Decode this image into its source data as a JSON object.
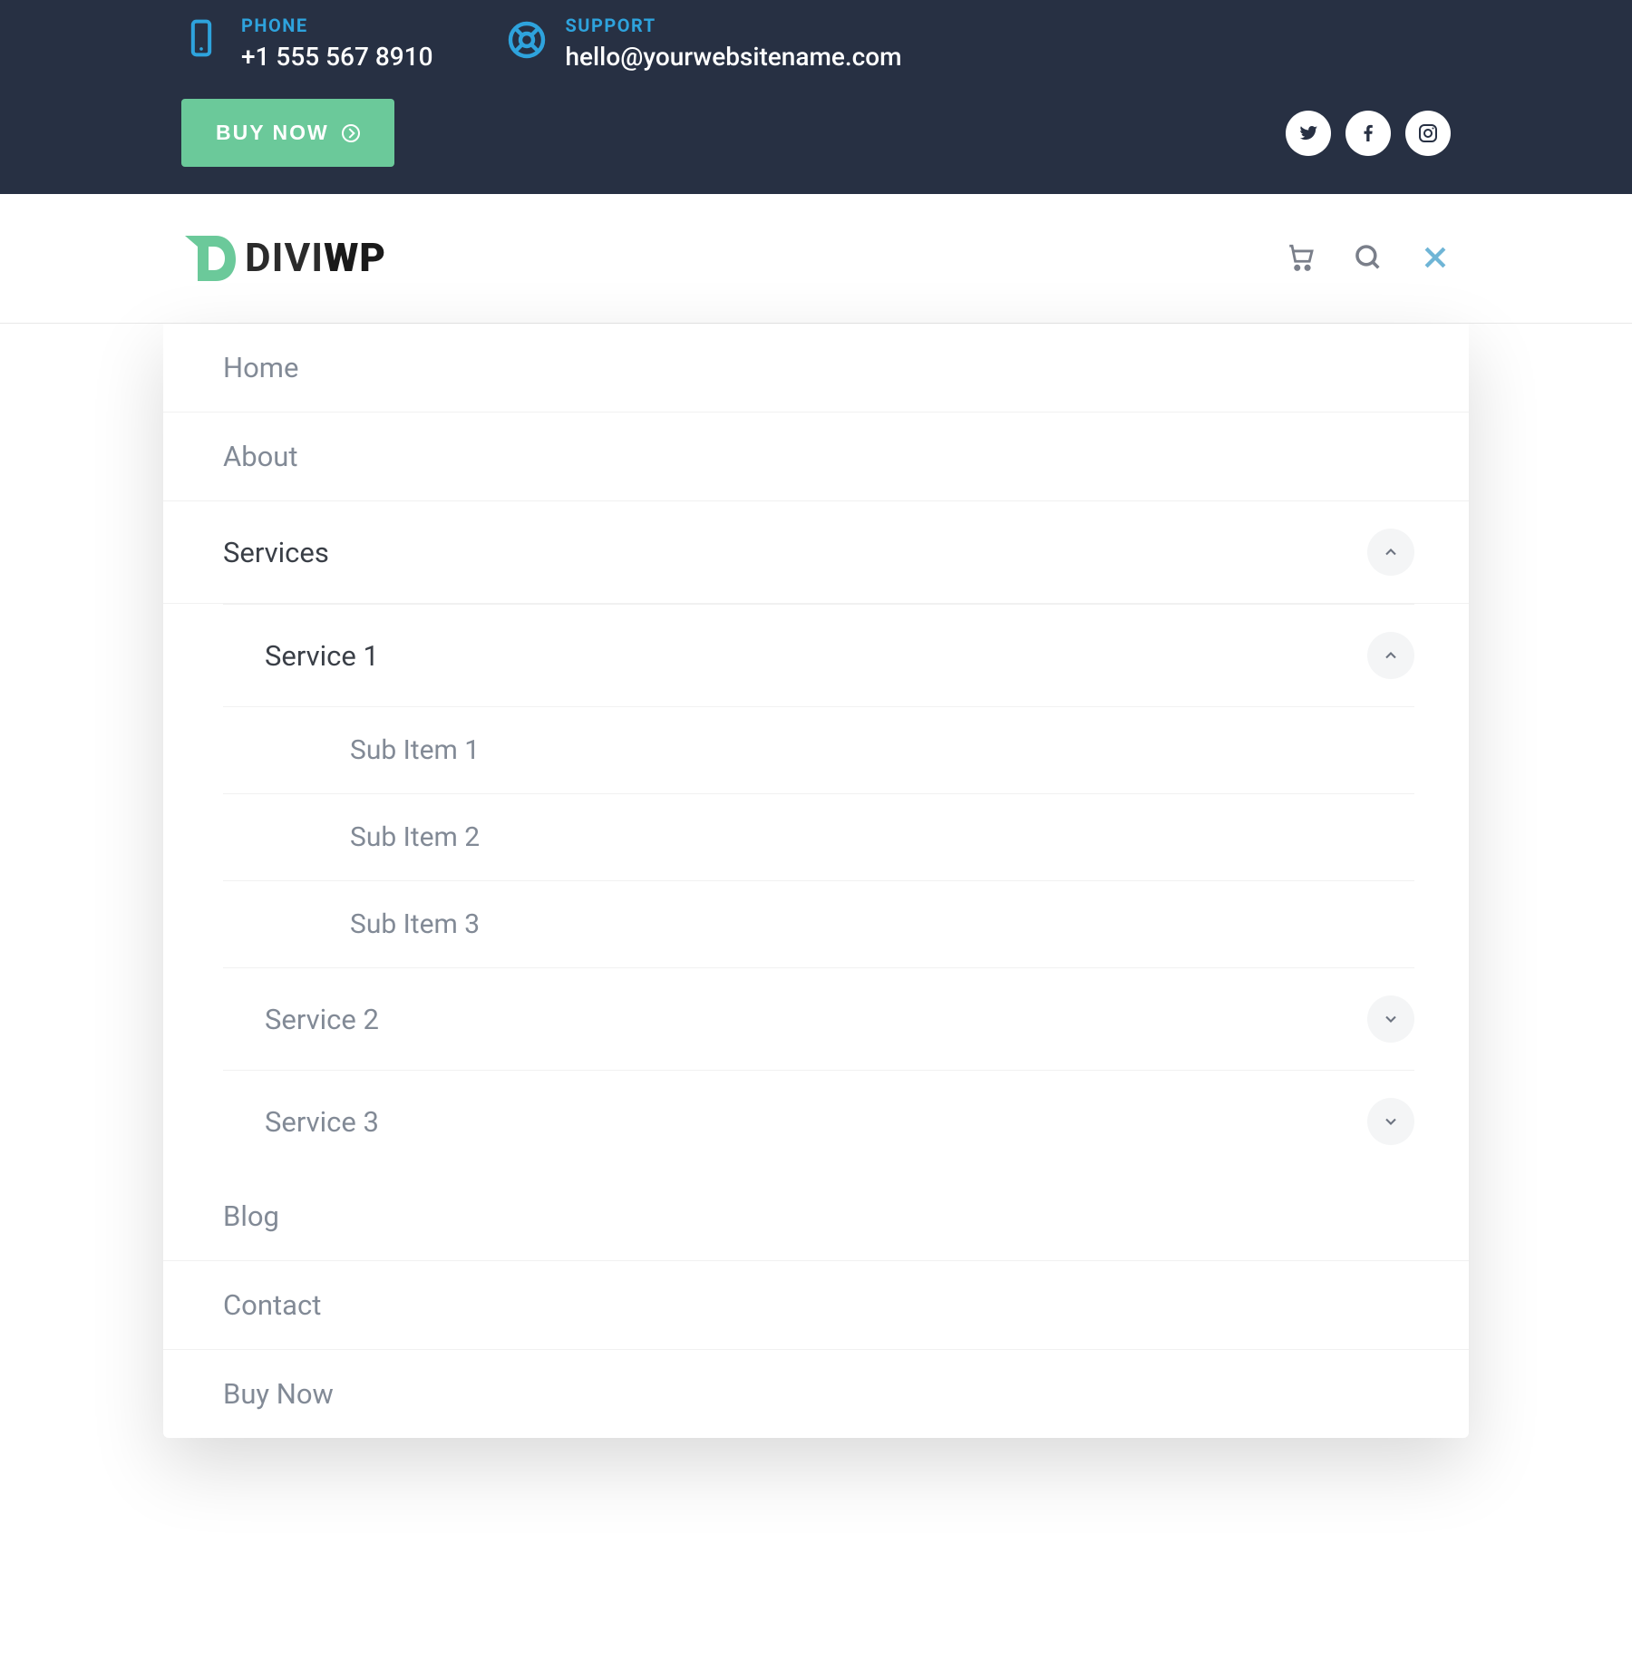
{
  "topbar": {
    "phone": {
      "label": "PHONE",
      "value": "+1 555 567 8910"
    },
    "support": {
      "label": "SUPPORT",
      "value": "hello@yourwebsitename.com"
    },
    "buy_label": "BUY NOW"
  },
  "logo": {
    "part1": "DIVI",
    "part2": "WP"
  },
  "menu": {
    "home": "Home",
    "about": "About",
    "services": "Services",
    "service1": "Service 1",
    "sub1": "Sub Item 1",
    "sub2": "Sub Item 2",
    "sub3": "Sub Item 3",
    "service2": "Service 2",
    "service3": "Service 3",
    "blog": "Blog",
    "contact": "Contact",
    "buynow": "Buy Now"
  }
}
